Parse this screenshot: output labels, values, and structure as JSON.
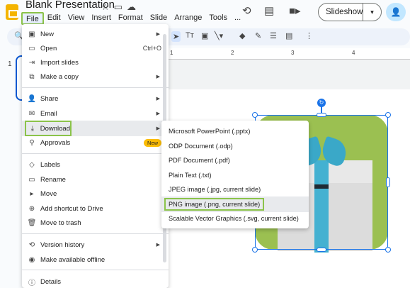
{
  "header": {
    "title": "Blank Presentation",
    "menus": [
      "File",
      "Edit",
      "View",
      "Insert",
      "Format",
      "Slide",
      "Arrange",
      "Tools",
      "..."
    ],
    "slideshow_label": "Slideshow"
  },
  "ruler": {
    "ticks": [
      "1",
      "2",
      "3",
      "4"
    ]
  },
  "filmstrip": {
    "slide_number": "1"
  },
  "file_menu": {
    "items": [
      {
        "label": "New",
        "shortcut": "",
        "icon": "new-icon",
        "submenu": true
      },
      {
        "label": "Open",
        "shortcut": "Ctrl+O",
        "icon": "folder-icon",
        "submenu": false
      },
      {
        "label": "Import slides",
        "shortcut": "",
        "icon": "import-icon",
        "submenu": false
      },
      {
        "label": "Make a copy",
        "shortcut": "",
        "icon": "copy-icon",
        "submenu": true
      },
      {
        "label": "Share",
        "shortcut": "",
        "icon": "share-icon",
        "submenu": true
      },
      {
        "label": "Email",
        "shortcut": "",
        "icon": "email-icon",
        "submenu": true
      },
      {
        "label": "Download",
        "shortcut": "",
        "icon": "download-icon",
        "submenu": true
      },
      {
        "label": "Approvals",
        "shortcut": "",
        "icon": "approvals-icon",
        "badge": "New"
      },
      {
        "label": "Labels",
        "shortcut": "",
        "icon": "label-icon",
        "submenu": false
      },
      {
        "label": "Rename",
        "shortcut": "",
        "icon": "rename-icon",
        "submenu": false
      },
      {
        "label": "Move",
        "shortcut": "",
        "icon": "move-icon",
        "submenu": false
      },
      {
        "label": "Add shortcut to Drive",
        "shortcut": "",
        "icon": "drive-shortcut-icon",
        "submenu": false
      },
      {
        "label": "Move to trash",
        "shortcut": "",
        "icon": "trash-icon",
        "submenu": false
      },
      {
        "label": "Version history",
        "shortcut": "",
        "icon": "history-icon",
        "submenu": true
      },
      {
        "label": "Make available offline",
        "shortcut": "",
        "icon": "offline-icon",
        "submenu": false
      },
      {
        "label": "Details",
        "shortcut": "",
        "icon": "info-icon",
        "submenu": false
      }
    ]
  },
  "download_submenu": {
    "items": [
      "Microsoft PowerPoint (.pptx)",
      "ODP Document (.odp)",
      "PDF Document (.pdf)",
      "Plain Text (.txt)",
      "JPEG image (.jpg, current slide)",
      "PNG image (.png, current slide)",
      "Scalable Vector Graphics (.svg, current slide)"
    ]
  },
  "colors": {
    "highlight": "#8bc34a",
    "accent": "#1a73e8",
    "logo": "#f4b400"
  }
}
